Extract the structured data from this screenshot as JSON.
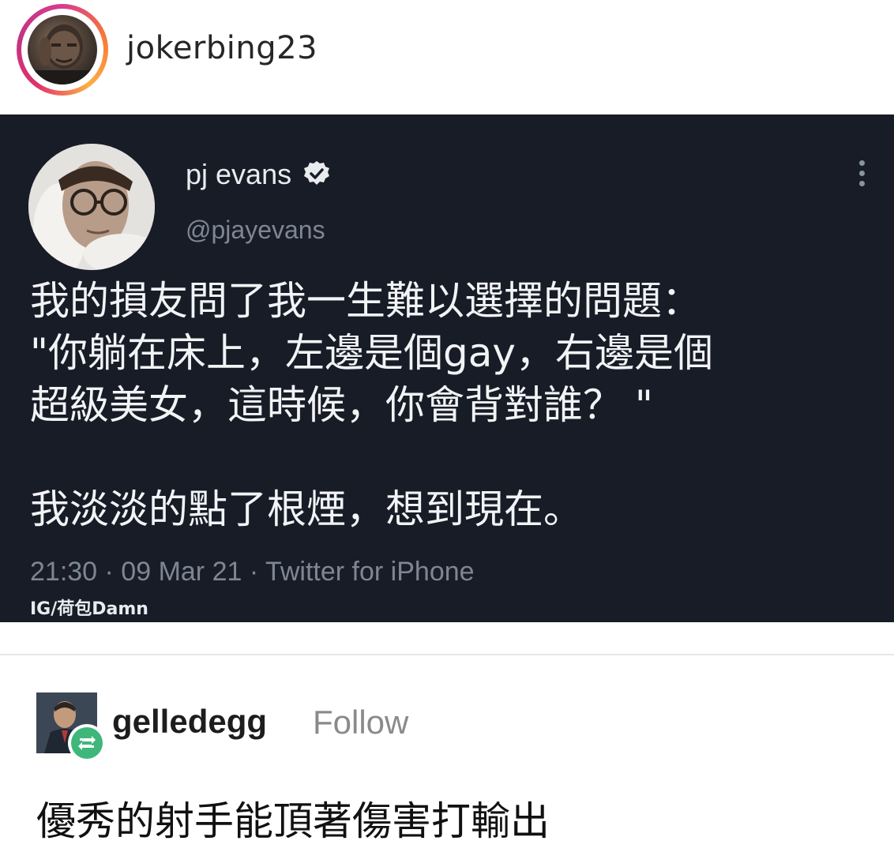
{
  "header": {
    "username": "jokerbing23"
  },
  "tweet": {
    "display_name": "pj evans",
    "handle": "@pjayevans",
    "body_lines": [
      "我的損友問了我一生難以選擇的問題：",
      "\"你躺在床上，左邊是個gay，右邊是個",
      "超級美女，這時候，你會背對誰？ \"",
      "我淡淡的點了根煙，想到現在。"
    ],
    "meta": "21:30 · 09 Mar 21 · Twitter for iPhone",
    "watermark": "IG/荷包Damn"
  },
  "reblog": {
    "username": "gelledegg",
    "follow_label": "Follow",
    "text": "優秀的射手能頂著傷害打輸出"
  },
  "icons": {
    "verified": "verified-badge-icon",
    "more": "more-options-icon",
    "reblog": "reblog-icon"
  },
  "colors": {
    "tweet_background": "#181c27",
    "reblog_badge": "#3fb77a"
  }
}
